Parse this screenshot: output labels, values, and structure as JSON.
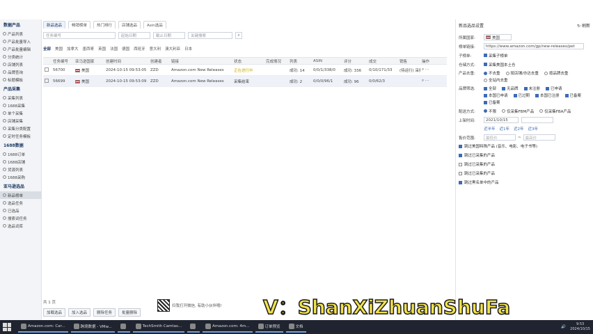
{
  "sidebar": {
    "sections": [
      {
        "title": "数据产品",
        "items": [
          "产品列表",
          "产品批量导入",
          "产品批量编辑",
          "分类统计",
          "店铺列表",
          "品牌查询",
          "标题模板"
        ]
      },
      {
        "title": "产品采集",
        "items": [
          "采集列表",
          "1688采集",
          "单个采集",
          "店铺采集",
          "采集分类配置",
          "定时任务模板"
        ]
      },
      {
        "title": "1688数据",
        "items": [
          "1688订单",
          "1688店铺",
          "货源列表",
          "1688采购"
        ]
      },
      {
        "title": "亚马逊选品",
        "items": [
          "新品榜单",
          "选品任务",
          "已选品",
          "搜索词任务",
          "选品词库"
        ]
      }
    ],
    "active_item": "新品榜单"
  },
  "tabs": [
    "新品选品",
    "畅销榜单",
    "热门排行",
    "店铺选品",
    "Asin选品"
  ],
  "search": {
    "task_placeholder": "任务编号",
    "start_date_placeholder": "起始日期",
    "end_date_placeholder": "截止日期",
    "keyword_placeholder": "关键搜索"
  },
  "filters": [
    "全部",
    "美国",
    "加拿大",
    "墨西哥",
    "英国",
    "法国",
    "德国",
    "西班牙",
    "意大利",
    "澳大利亚",
    "日本"
  ],
  "table": {
    "headers": [
      "",
      "任务编号",
      "亚马逊国家",
      "创建时间",
      "创建者",
      "链接",
      "状态",
      "完成情况",
      "列表",
      "ASIN",
      "评分",
      "成交",
      "销售",
      "操作"
    ],
    "rows": [
      {
        "id": "56700",
        "country": "美国",
        "created": "2024-10-15 09:53:05",
        "creator": "ZZD",
        "link": "Amazon.com New Releases",
        "status": "正在进行中",
        "done": "",
        "list": "成功: 14",
        "asin": "0/0/1/338/0",
        "rating": "成功: 336",
        "deals": "0/10/171/33",
        "sales": "(待运行) 采集",
        "ops": ""
      },
      {
        "id": "56699",
        "country": "美国",
        "created": "2024-10-15 09:53:09",
        "creator": "ZZD",
        "link": "Amazon.com New Releases",
        "status": "采集结束",
        "done": "",
        "list": "成功: 2",
        "asin": "0/0/0/96/1",
        "rating": "成功: 96",
        "deals": "0/0/62/3",
        "sales": "",
        "ops": ""
      }
    ]
  },
  "pager": "共 1 页",
  "bottom_buttons": [
    "加载选品",
    "加入选品",
    "删除任务",
    "批量删除"
  ],
  "promo_text": "扫我打开微信, 有助小伙伴哦!",
  "right_panel": {
    "title": "新品选品设置",
    "refresh_label": "刷新",
    "site_label": "所属国家:",
    "site_value": "美国",
    "url_label": "榜单链接:",
    "url_value": "https://www.amazon.com/gp/new-releases/pet",
    "sub_label": "子榜单:",
    "sub_option": "采集子榜单",
    "ship_label": "仓储方式:",
    "ship_option": "采集美国本土仓",
    "product_label": "产品去重:",
    "product_options": [
      "不去重",
      "按店铺/亦达去重",
      "按品牌去重",
      "全站内去重"
    ],
    "brand_label": "品牌筛选:",
    "brand_options": [
      "全部",
      "无品牌",
      "未注册",
      "已申请",
      "本国已申请",
      "已过期",
      "本国已注册",
      "已备案",
      "已备案"
    ],
    "fulfill_label": "配送方式:",
    "fulfill_options": [
      "不限",
      "仅采集FBM产品",
      "仅采集FBA产品"
    ],
    "listed_label": "上架时间:",
    "listed_value": "2021/10/15",
    "listed_quick": [
      "近半年",
      "近1年",
      "近2年",
      "近3年"
    ],
    "price_label": "售价范围:",
    "price_min_placeholder": "最低价",
    "price_max_placeholder": "最高价",
    "checks": [
      {
        "label": "跳过美国特殊产品 (音乐、电影、电子书等)",
        "on": true
      },
      {
        "label": "跳过已采集的产品",
        "on": true
      },
      {
        "label": "跳过已采集的产品",
        "on": false
      },
      {
        "label": "跳过已采集的产品",
        "on": false
      },
      {
        "label": "跳过黑名单中的产品",
        "on": true
      }
    ]
  },
  "watermark": "V：ShanXiZhuanShuFa",
  "taskbar": {
    "items": [
      "Amazon.com: Car...",
      "跨境数据 - VMw...",
      "",
      "TechSmith Camtas...",
      "",
      "Amazon.com: 4m...",
      "订单预览",
      "文档"
    ],
    "time": "9:53",
    "date": "2024/10/15"
  }
}
